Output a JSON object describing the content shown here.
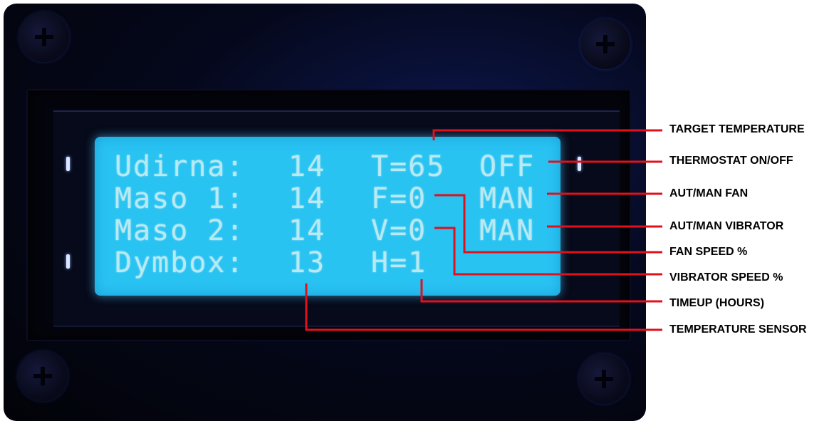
{
  "lcd": {
    "rows": [
      {
        "label": "Udirna:",
        "value": "14",
        "var": "T=65",
        "mode": "OFF"
      },
      {
        "label": "Maso 1:",
        "value": "14",
        "var": "F=0",
        "mode": "MAN"
      },
      {
        "label": "Maso 2:",
        "value": "14",
        "var": "V=0",
        "mode": "MAN"
      },
      {
        "label": "Dymbox:",
        "value": "13",
        "var": "H=1",
        "mode": ""
      }
    ],
    "backlight_color": "#29c3f2",
    "text_color": "#b9e9f2"
  },
  "callouts": {
    "target_temperature": "TARGET TEMPERATURE",
    "thermostat": "THERMOSTAT ON/OFF",
    "aut_man_fan": "AUT/MAN FAN",
    "aut_man_vibrator": "AUT/MAN VIBRATOR",
    "fan_speed": "FAN SPEED %",
    "vibrator_speed": "VIBRATOR SPEED %",
    "timeup": "TIMEUP (HOURS)",
    "temperature_sensor": "TEMPERATURE SENSOR"
  },
  "colors": {
    "leader_line": "#e0101c",
    "device_body": "#05081c"
  }
}
